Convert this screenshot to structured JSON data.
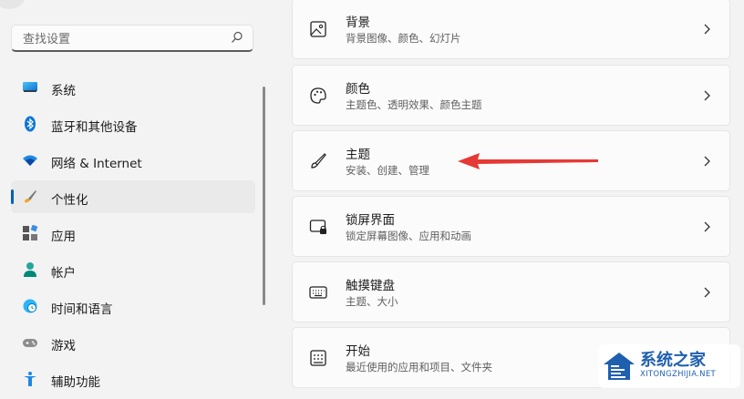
{
  "search": {
    "placeholder": "查找设置"
  },
  "sidebar": {
    "items": [
      {
        "label": "系统",
        "icon": "monitor-icon"
      },
      {
        "label": "蓝牙和其他设备",
        "icon": "bluetooth-icon"
      },
      {
        "label": "网络 & Internet",
        "icon": "wifi-icon"
      },
      {
        "label": "个性化",
        "icon": "brush-icon",
        "active": true
      },
      {
        "label": "应用",
        "icon": "apps-icon"
      },
      {
        "label": "帐户",
        "icon": "person-icon"
      },
      {
        "label": "时间和语言",
        "icon": "globe-clock-icon"
      },
      {
        "label": "游戏",
        "icon": "gamepad-icon"
      },
      {
        "label": "辅助功能",
        "icon": "accessibility-icon"
      }
    ]
  },
  "cards": [
    {
      "title": "背景",
      "desc": "背景图像、颜色、幻灯片",
      "icon": "picture-icon"
    },
    {
      "title": "颜色",
      "desc": "主题色、透明效果、颜色主题",
      "icon": "palette-icon"
    },
    {
      "title": "主题",
      "desc": "安装、创建、管理",
      "icon": "brush-icon"
    },
    {
      "title": "锁屏界面",
      "desc": "锁定屏幕图像、应用和动画",
      "icon": "lock-screen-icon"
    },
    {
      "title": "触摸键盘",
      "desc": "主题、大小",
      "icon": "keyboard-icon"
    },
    {
      "title": "开始",
      "desc": "最近使用的应用和项目、文件夹",
      "icon": "start-icon"
    }
  ],
  "watermark": {
    "cn": "系统之家",
    "en": "XITONGZHIJIA.NET"
  },
  "colors": {
    "accent": "#005fb8",
    "arrow": "#e53935",
    "watermark": "#1f5fb0"
  }
}
